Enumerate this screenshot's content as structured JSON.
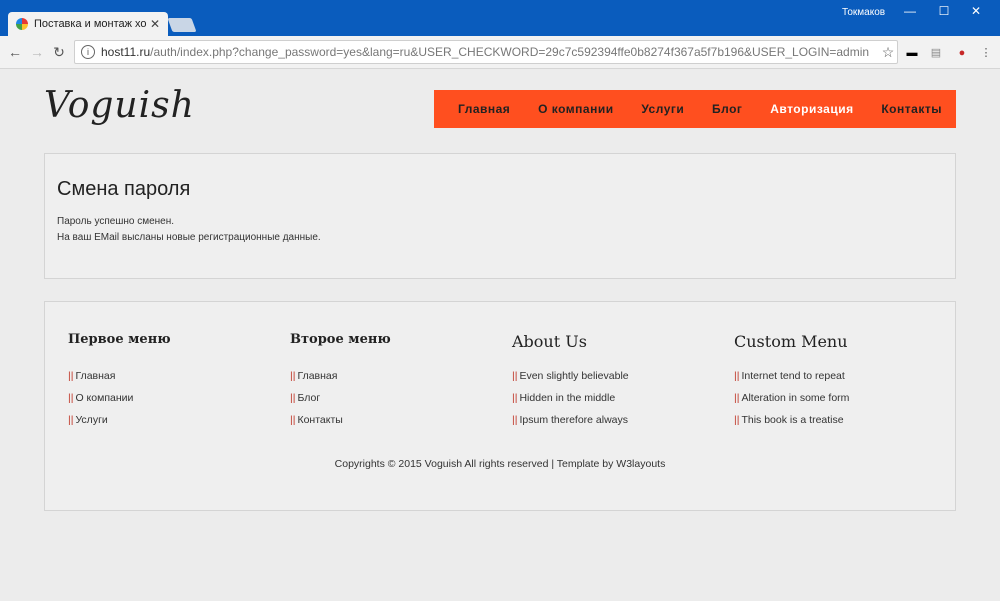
{
  "browser": {
    "tab_title": "Поставка и монтаж хол",
    "tab_close": "✕",
    "user": "Токмаков",
    "url_host": "host11.ru",
    "url_rest": "/auth/index.php?change_password=yes&lang=ru&USER_CHECKWORD=29c7c592394ffe0b8274f367a5f7b196&USER_LOGIN=admin"
  },
  "site": {
    "logo": "Voguish",
    "menu": [
      {
        "label": "Главная",
        "active": false
      },
      {
        "label": "О компании",
        "active": false
      },
      {
        "label": "Услуги",
        "active": false
      },
      {
        "label": "Блог",
        "active": false
      },
      {
        "label": "Авторизация",
        "active": true
      },
      {
        "label": "Контакты",
        "active": false
      }
    ],
    "accent_color": "#ff4f1f"
  },
  "content": {
    "title": "Смена пароля",
    "line1": "Пароль успешно сменен.",
    "line2": "На ваш EMail высланы новые регистрационные данные."
  },
  "footer": {
    "columns": [
      {
        "title": "Первое меню",
        "items": [
          "Главная",
          "О компании",
          "Услуги"
        ]
      },
      {
        "title": "Второе меню",
        "items": [
          "Главная",
          "Блог",
          "Контакты"
        ]
      },
      {
        "title": "About Us",
        "items": [
          "Even slightly believable",
          "Hidden in the middle",
          "Ipsum therefore always"
        ]
      },
      {
        "title": "Custom Menu",
        "items": [
          "Internet tend to repeat",
          "Alteration in some form",
          "This book is a treatise"
        ]
      }
    ],
    "bar": "||",
    "copyright": "Copyrights © 2015 Voguish All rights reserved | Template by W3layouts"
  }
}
